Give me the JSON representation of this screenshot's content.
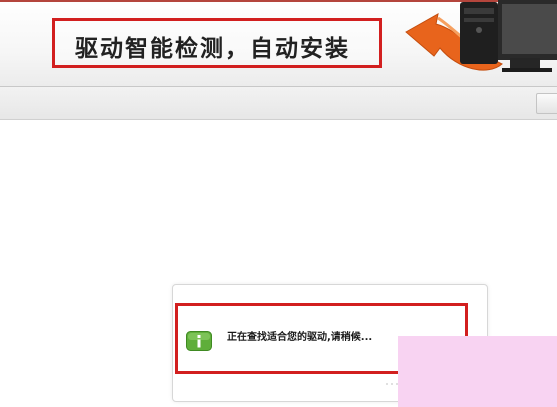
{
  "banner": {
    "title": "驱动智能检测，自动安装",
    "graphic_icon": "desktop-pc-with-arrow-icon",
    "highlight_color": "#d21f1f",
    "arrow_color": "#e8641c"
  },
  "toolbar": {
    "button_icon": "blank-button-icon"
  },
  "notice": {
    "icon": "info-icon",
    "icon_color": "#5fae3a",
    "status_text": "正在查找适合您的驱动,请稍候..."
  },
  "overlay": {
    "color": "#f8d3f2"
  }
}
